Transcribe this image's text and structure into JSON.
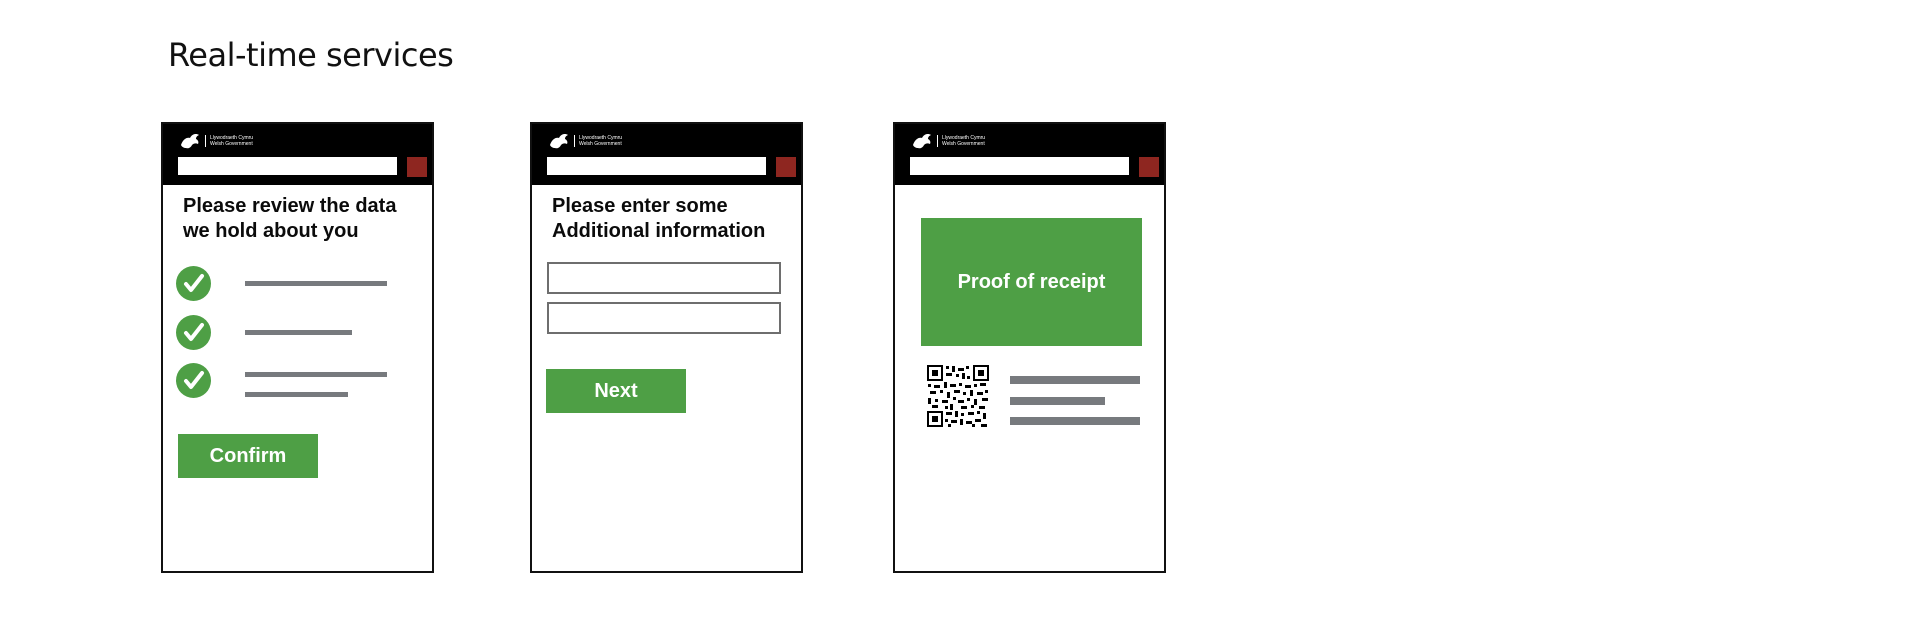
{
  "title": "Real-time services",
  "logo": {
    "line1": "Llywodraeth Cymru",
    "line2": "Welsh Government",
    "icon": "dragon-icon"
  },
  "colors": {
    "header": "#000000",
    "search_button": "#8e2620",
    "green": "#4e9f45",
    "placeholder_line": "#777a7e"
  },
  "screens": [
    {
      "heading": "Please review the data we hold about you",
      "items": [
        {
          "icon": "check-icon"
        },
        {
          "icon": "check-icon"
        },
        {
          "icon": "check-icon"
        }
      ],
      "button_label": "Confirm"
    },
    {
      "heading": "Please enter some Additional information",
      "fields": [
        "",
        ""
      ],
      "button_label": "Next"
    },
    {
      "receipt_label": "Proof of receipt",
      "qr_icon": "qr-code-icon"
    }
  ]
}
